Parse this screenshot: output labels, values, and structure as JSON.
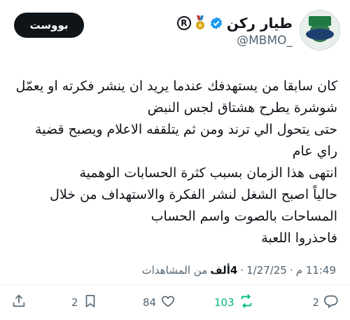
{
  "author": {
    "display_name": "طيار ركن",
    "handle": "@MBMO_",
    "registered_mark": "R",
    "badges": [
      "verified-icon",
      "medal-icon",
      "registered-icon"
    ]
  },
  "boost_button": {
    "label": "بووست"
  },
  "tweet": {
    "lines": [
      "كان سابقا من يستهدفك عندما يريد ان ينشر فكرته او يعمّل",
      "شوشرة يطرح هشتاق لجس النبض",
      "حتى يتحول الي ترند ومن ثم يتلقفه الاعلام ويصبح قضية",
      "راي عام",
      "انتهى هذا الزمان بسبب كثرة الحسابات الوهمية",
      "حالياً اصبح الشغل لنشر الفكرة والاستهداف من خلال",
      "المساحات بالصوت واسم الحساب",
      "فاحذروا اللعبة"
    ]
  },
  "meta": {
    "time": "11:49 م",
    "separator": "·",
    "date": "1/27/25",
    "views_count": "4ألف",
    "views_label": "من المشاهدات"
  },
  "actions": {
    "replies": "2",
    "retweets": "103",
    "likes": "84",
    "bookmarks": "2"
  },
  "colors": {
    "retweet_accent": "#00ba7c",
    "verified_blue": "#1d9bf0",
    "secondary_text": "#536471"
  }
}
